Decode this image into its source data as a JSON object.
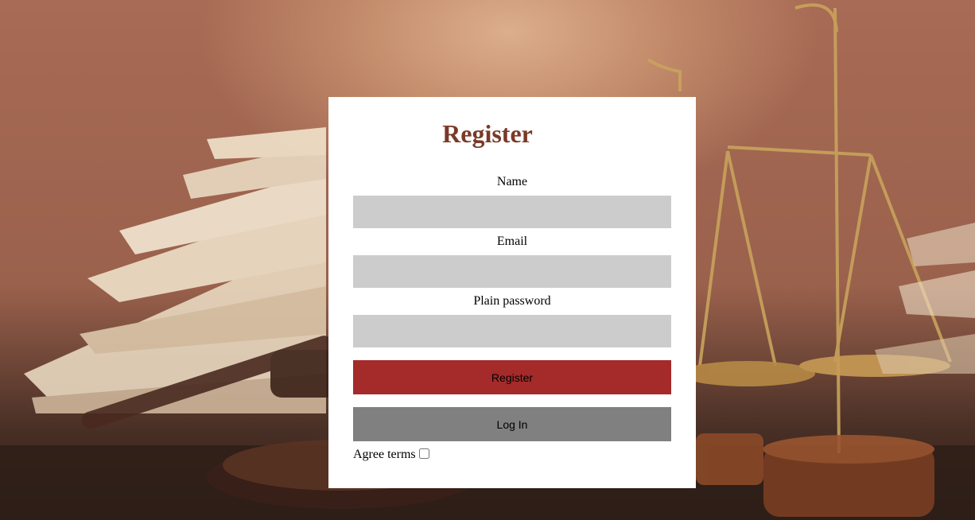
{
  "form": {
    "title": "Register",
    "name_label": "Name",
    "name_value": "",
    "email_label": "Email",
    "email_value": "",
    "password_label": "Plain password",
    "password_value": "",
    "register_button": "Register",
    "login_button": "Log In",
    "agree_label": "Agree terms",
    "agree_checked": false
  },
  "colors": {
    "title": "#7a3a28",
    "input_bg": "#cccccc",
    "register_bg": "#a52a2a",
    "login_bg": "#808080"
  },
  "background": {
    "scene": "law-books-and-scales-icon"
  }
}
